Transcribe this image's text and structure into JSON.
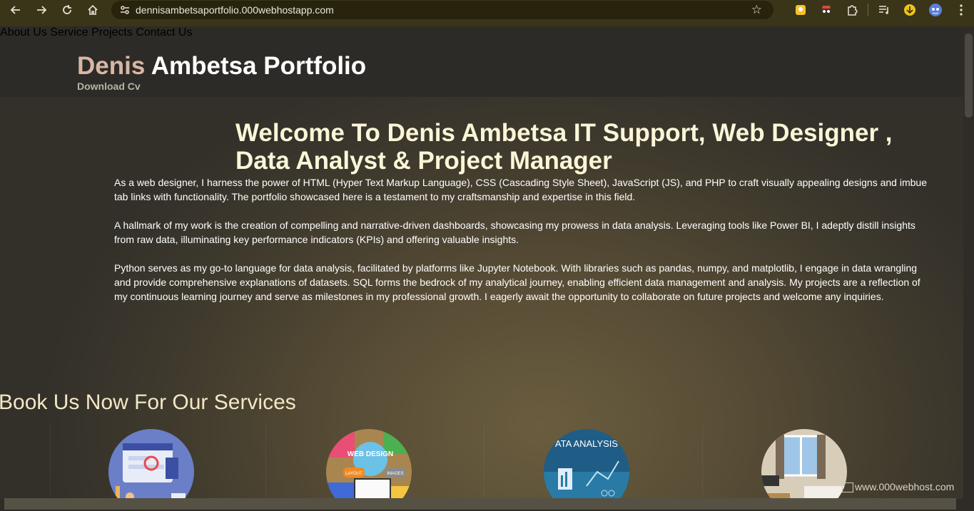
{
  "browser": {
    "url": "dennisambetsaportfolio.000webhostapp.com"
  },
  "header": {
    "brand_first": "Denis",
    "brand_rest": "Ambetsa Portfolio",
    "download": "Download Cv",
    "nav": [
      "About Us",
      "Service",
      "Projects",
      "Contact Us"
    ]
  },
  "hero": {
    "title": "Welcome To Denis Ambetsa IT Support, Web Designer , Data Analyst & Project Manager",
    "paragraphs": [
      "As a web designer, I harness the power of HTML (Hyper Text Markup Language), CSS (Cascading Style Sheet), JavaScript (JS), and PHP to craft visually appealing designs and imbue tab links with functionality. The portfolio showcased here is a testament to my craftsmanship and expertise in this field.",
      "A hallmark of my work is the creation of compelling and narrative-driven dashboards, showcasing my prowess in data analysis. Leveraging tools like Power BI, I adeptly distill insights from raw data, illuminating key performance indicators (KPIs) and offering valuable insights.",
      "Python serves as my go-to language for data analysis, facilitated by platforms like Jupyter Notebook. With libraries such as pandas, numpy, and matplotlib, I engage in data wrangling and provide comprehensive explanations of datasets. SQL forms the bedrock of my analytical journey, enabling efficient data management and analysis. My projects are a reflection of my continuous learning journey and serve as milestones in my professional growth. I eagerly await the opportunity to collaborate on future projects and welcome any inquiries."
    ]
  },
  "services": {
    "heading": "Book Us Now For Our Services",
    "images": [
      {
        "label": ""
      },
      {
        "label": "WEB DESIGN",
        "sub1": "LAYOUT",
        "sub2": "IMAGES"
      },
      {
        "label": "ATA ANALYSIS"
      },
      {
        "label": ""
      }
    ]
  },
  "watermark": "www.000webhost.com",
  "colors": {
    "accent_brand": "#d9b7a5",
    "nav_text": "#ecd0b5",
    "hero_title": "#fbf6d7"
  }
}
